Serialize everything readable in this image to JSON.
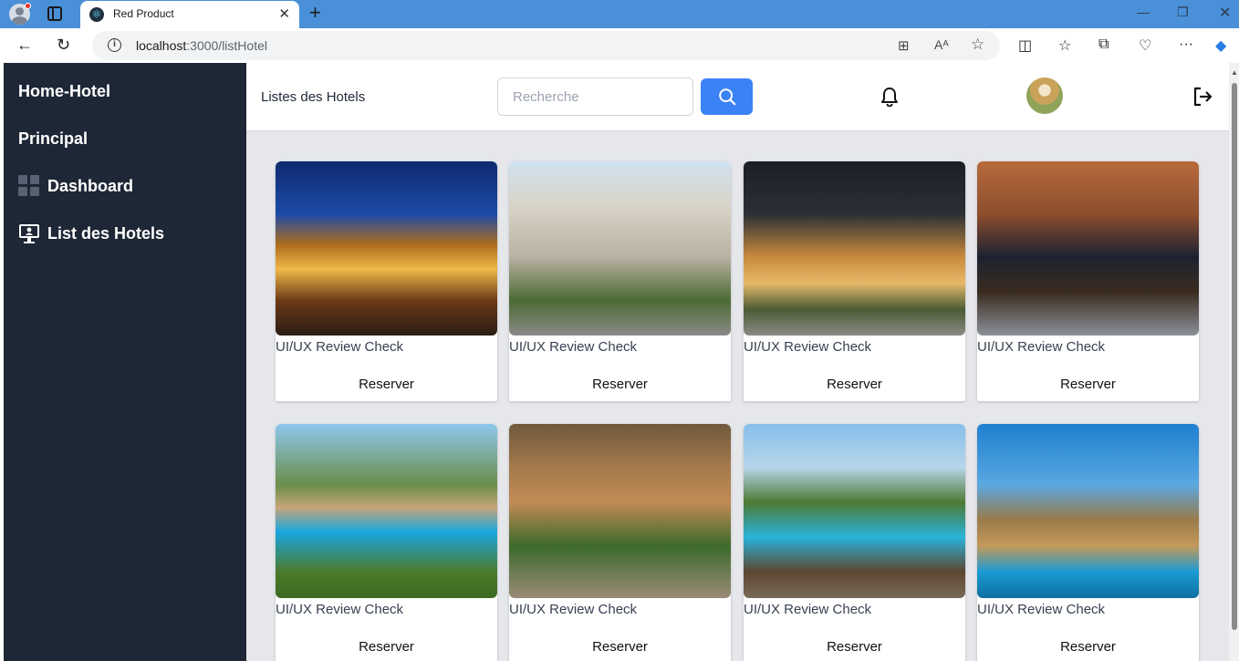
{
  "browser": {
    "tab_title": "Red Product",
    "url_host": "localhost",
    "url_path": ":3000/listHotel"
  },
  "sidebar": {
    "brand": "Home-Hotel",
    "section": "Principal",
    "items": [
      {
        "label": "Dashboard",
        "icon": "dashboard-icon"
      },
      {
        "label": "List des Hotels",
        "icon": "hotel-list-icon"
      }
    ]
  },
  "header": {
    "title": "Listes des Hotels",
    "search_placeholder": "Recherche",
    "search_value": ""
  },
  "hotels": [
    {
      "name": "UI/UX Review Check",
      "button": "Reserver"
    },
    {
      "name": "UI/UX Review Check",
      "button": "Reserver"
    },
    {
      "name": "UI/UX Review Check",
      "button": "Reserver"
    },
    {
      "name": "UI/UX Review Check",
      "button": "Reserver"
    },
    {
      "name": "UI/UX Review Check",
      "button": "Reserver"
    },
    {
      "name": "UI/UX Review Check",
      "button": "Reserver"
    },
    {
      "name": "UI/UX Review Check",
      "button": "Reserver"
    },
    {
      "name": "UI/UX Review Check",
      "button": "Reserver"
    }
  ],
  "colors": {
    "sidebar_bg": "#1e2736",
    "accent": "#3b82f6",
    "content_bg": "#e5e7eb",
    "tabbar": "#4a90d9"
  }
}
